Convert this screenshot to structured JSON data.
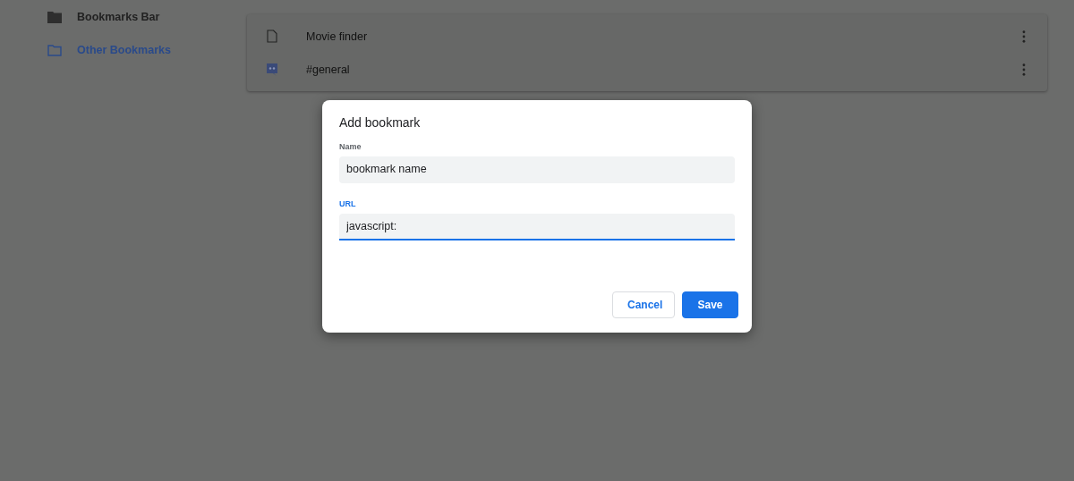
{
  "sidebar": {
    "items": [
      {
        "label": "Bookmarks Bar",
        "selected": false
      },
      {
        "label": "Other Bookmarks",
        "selected": true
      }
    ]
  },
  "bookmarks": [
    {
      "title": "Movie finder",
      "kind": "page"
    },
    {
      "title": "#general",
      "kind": "chat"
    }
  ],
  "dialog": {
    "title": "Add bookmark",
    "fields": [
      {
        "label": "Name",
        "value": "bookmark name",
        "focused": false
      },
      {
        "label": "URL",
        "value": "javascript:",
        "focused": true
      }
    ],
    "buttons": [
      {
        "label": "Cancel",
        "kind": "secondary"
      },
      {
        "label": "Save",
        "kind": "primary"
      }
    ]
  }
}
